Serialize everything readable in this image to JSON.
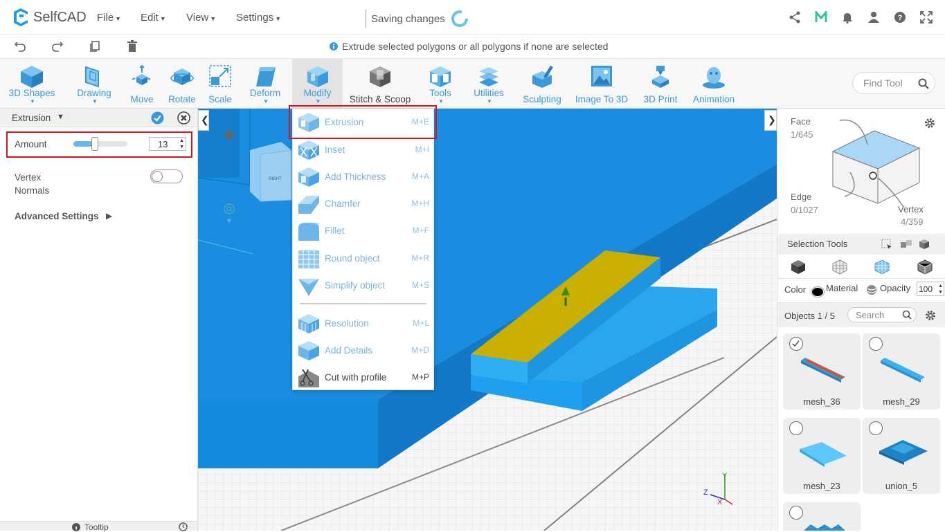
{
  "app": {
    "logo_text": "SelfCAD"
  },
  "menus": {
    "file": "File",
    "edit": "Edit",
    "view": "View",
    "settings": "Settings"
  },
  "status": {
    "saving": "Saving changes"
  },
  "hint": {
    "text": "Extrude selected polygons or all polygons if none are selected"
  },
  "toolbar": {
    "items": [
      "3D Shapes",
      "Drawing",
      "Move",
      "Rotate",
      "Scale",
      "Deform",
      "Modify",
      "Stitch & Scoop",
      "Tools",
      "Utilities",
      "Sculpting",
      "Image To 3D",
      "3D Print",
      "Animation"
    ],
    "find_placeholder": "Find Tool"
  },
  "panel": {
    "title": "Extrusion",
    "amount_label": "Amount",
    "amount_value": "13",
    "vertex_normals_label": "Vertex Normals",
    "advanced": "Advanced Settings",
    "tooltip": "Tooltip",
    "amount_slider_fraction": 0.4
  },
  "dropdown": {
    "items": [
      {
        "label": "Extrusion",
        "shortcut": "M+E"
      },
      {
        "label": "Inset",
        "shortcut": "M+I"
      },
      {
        "label": "Add Thickness",
        "shortcut": "M+A"
      },
      {
        "label": "Chamfer",
        "shortcut": "M+H"
      },
      {
        "label": "Fillet",
        "shortcut": "M+F"
      },
      {
        "label": "Round object",
        "shortcut": "M+R"
      },
      {
        "label": "Simplify object",
        "shortcut": "M+S"
      },
      {
        "label": "Resolution",
        "shortcut": "M+L"
      },
      {
        "label": "Add Details",
        "shortcut": "M+D"
      },
      {
        "label": "Cut with profile",
        "shortcut": "M+P"
      }
    ]
  },
  "selection": {
    "face_label": "Face",
    "face_count": "1/645",
    "edge_label": "Edge",
    "edge_count": "0/1027",
    "vertex_label": "Vertex",
    "vertex_count": "4/359",
    "tools_label": "Selection Tools"
  },
  "props": {
    "color_label": "Color",
    "material_label": "Material",
    "opacity_label": "Opacity",
    "opacity_value": "100"
  },
  "objects": {
    "header": "Objects 1 / 5",
    "search_placeholder": "Search",
    "items": [
      "mesh_36",
      "mesh_29",
      "mesh_23",
      "union_5"
    ]
  },
  "viewcube": {
    "label": "RIGHT"
  },
  "axes": {
    "y": "Y",
    "z": "Z",
    "x": "X"
  },
  "colors": {
    "accent": "#3a9ad9",
    "object_blue": "#1e9ae8",
    "selected_face": "#c9b000",
    "highlight_red": "#d9121c"
  }
}
